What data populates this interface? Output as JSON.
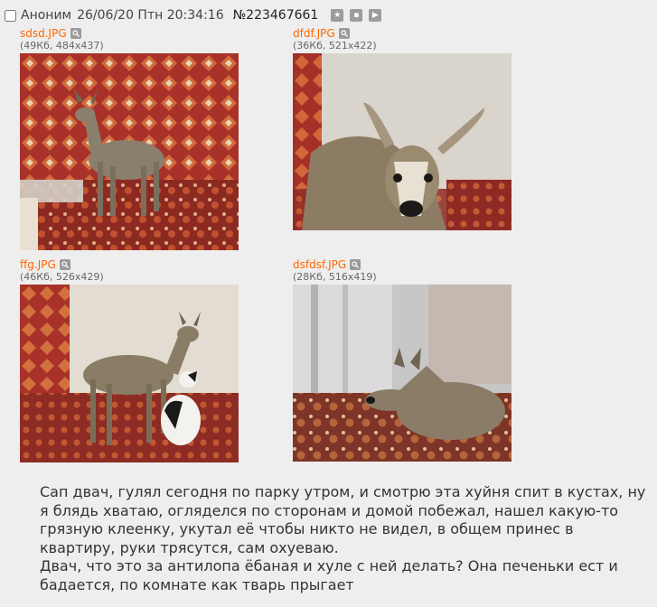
{
  "post": {
    "author": "Аноним",
    "date": "26/06/20 Птн 20:34:16",
    "number": "№223467661",
    "icons": [
      "star-icon",
      "hide-icon",
      "play-icon"
    ]
  },
  "files": [
    {
      "name": "sdsd.JPG",
      "meta": "(49Кб, 484x437)"
    },
    {
      "name": "dfdf.JPG",
      "meta": "(36Кб, 521x422)"
    },
    {
      "name": "ffg.JPG",
      "meta": "(46Кб, 526x429)"
    },
    {
      "name": "dsfdsf.JPG",
      "meta": "(28Кб, 516x419)"
    }
  ],
  "text": {
    "paragraph1": "Сап двач, гулял сегодня по парку утром, и смотрю эта хуйня спит в кустах, ну я блядь хватаю, огляделся по сторонам и домой побежал, нашел какую-то грязную клеенку, укутал её чтобы никто не видел, в общем принес в квартиру, руки трясутся, сам охуеваю.",
    "paragraph2": "Двач, что это за антилопа ёбаная и хуле с ней делать? Она печеньки ест и бадается, по комнате как тварь прыгает"
  },
  "colors": {
    "background": "#eeeeee",
    "link": "#ff6600"
  }
}
